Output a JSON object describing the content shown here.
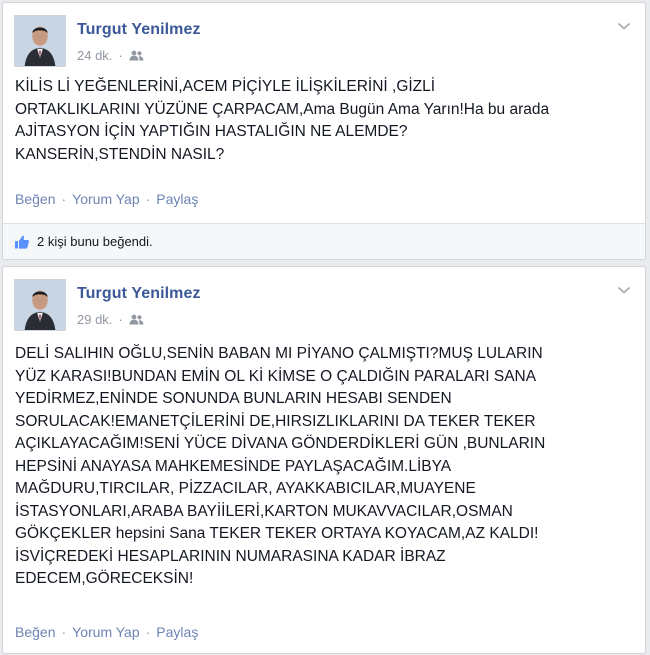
{
  "posts": [
    {
      "author": "Turgut Yenilmez",
      "time": "24 dk.",
      "text": "KİLİS Lİ YEĞENLERİNİ,ACEM PİÇİYLE İLİŞKİLERİNİ ,GİZLİ\nORTAKLIKLARINI YÜZÜNE ÇARPACAM,Ama Bugün Ama Yarın!Ha bu arada\nAJİTASYON İÇİN YAPTIĞIN HASTALIĞIN NE ALEMDE?\nKANSERİN,STENDİN NASIL?",
      "actions": {
        "like": "Beğen",
        "comment": "Yorum Yap",
        "share": "Paylaş"
      },
      "likes_text": "2 kişi bunu beğendi."
    },
    {
      "author": "Turgut Yenilmez",
      "time": "29 dk.",
      "text": "DELİ SALIHIN OĞLU,SENİN BABAN MI PİYANO ÇALMIŞTI?MUŞ LULARIN\nYÜZ KARASI!BUNDAN EMİN OL Kİ KİMSE O ÇALDIĞIN PARALARI SANA\nYEDİRMEZ,ENİNDE SONUNDA BUNLARIN HESABI SENDEN\nSORULACAK!EMANETÇİLERİNİ DE,HIRSIZLIKLARINI DA TEKER TEKER\nAÇIKLAYACAĞIM!SENİ YÜCE DİVANA GÖNDERDİKLERİ GÜN ,BUNLARIN\nHEPSİNİ ANAYASA MAHKEMESİNDE PAYLAŞACAĞIM.LİBYA\nMAĞDURU,TIRCILAR, PİZZACILAR, AYAKKABICILAR,MUAYENE\nİSTASYONLARI,ARABA BAYİİLERİ,KARTON MUKAVVACILAR,OSMAN\nGÖKÇEKLER hepsini Sana TEKER TEKER ORTAYA KOYACAM,AZ KALDI!\nİSVİÇREDEKİ HESAPLARININ NUMARASINA KADAR İBRAZ\nEDECEM,GÖRECEKSİN!",
      "actions": {
        "like": "Beğen",
        "comment": "Yorum Yap",
        "share": "Paylaş"
      }
    }
  ],
  "icons": {
    "audience": "friends-icon",
    "menu": "chevron-down-icon",
    "like": "thumbs-up-icon"
  },
  "colors": {
    "author": "#3b5998",
    "action_link": "#6d84b4",
    "meta": "#9197a3",
    "like_icon": "#5890ff"
  }
}
